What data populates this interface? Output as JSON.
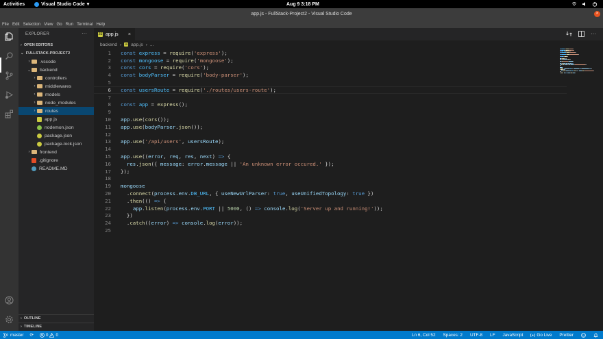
{
  "topbar": {
    "activities": "Activities",
    "app": "Visual Studio Code",
    "app_chevron": "▾",
    "clock": "Aug 9   3:18 PM",
    "tray_icons": [
      "network-icon",
      "volume-icon",
      "power-icon"
    ]
  },
  "window": {
    "title": "app.js - FullStack-Project2 - Visual Studio Code",
    "close_glyph": "×"
  },
  "menu": [
    "File",
    "Edit",
    "Selection",
    "View",
    "Go",
    "Run",
    "Terminal",
    "Help"
  ],
  "sidebar": {
    "title": "EXPLORER",
    "more": "···",
    "open_editors": "OPEN EDITORS",
    "project": "FULLSTACK-PROJECT2",
    "outline": "OUTLINE",
    "timeline": "TIMELINE",
    "tree": [
      {
        "label": ".vscode",
        "kind": "folder",
        "indent": 1,
        "expanded": false
      },
      {
        "label": "backend",
        "kind": "folder",
        "indent": 1,
        "expanded": true
      },
      {
        "label": "controllers",
        "kind": "folder",
        "indent": 2,
        "expanded": false
      },
      {
        "label": "middlewares",
        "kind": "folder",
        "indent": 2,
        "expanded": false
      },
      {
        "label": "models",
        "kind": "folder",
        "indent": 2,
        "expanded": false
      },
      {
        "label": "node_modules",
        "kind": "folder",
        "indent": 2,
        "expanded": false
      },
      {
        "label": "routes",
        "kind": "folder",
        "indent": 2,
        "expanded": false,
        "selected": true
      },
      {
        "label": "app.js",
        "kind": "js",
        "indent": 2
      },
      {
        "label": "nodemon.json",
        "kind": "nodemon",
        "indent": 2
      },
      {
        "label": "package.json",
        "kind": "json",
        "indent": 2
      },
      {
        "label": "package-lock.json",
        "kind": "json",
        "indent": 2
      },
      {
        "label": "frontend",
        "kind": "folder",
        "indent": 1,
        "expanded": false
      },
      {
        "label": ".gitignore",
        "kind": "git",
        "indent": 1
      },
      {
        "label": "README.MD",
        "kind": "md",
        "indent": 1
      }
    ]
  },
  "tab": {
    "label": "app.js",
    "icon": "JS",
    "close": "×"
  },
  "breadcrumb": {
    "folder": "backend",
    "sep": "›",
    "file": "app.js",
    "more": "..."
  },
  "editor": {
    "current_line": 6,
    "lines": [
      [
        [
          "kw",
          "const "
        ],
        [
          "cls",
          "express"
        ],
        [
          "plain",
          " = "
        ],
        [
          "fn",
          "require"
        ],
        [
          "plain",
          "("
        ],
        [
          "str",
          "'express'"
        ],
        [
          "plain",
          ");"
        ]
      ],
      [
        [
          "kw",
          "const "
        ],
        [
          "cls",
          "mongoose"
        ],
        [
          "plain",
          " = "
        ],
        [
          "fn",
          "require"
        ],
        [
          "plain",
          "("
        ],
        [
          "str",
          "'mongoose'"
        ],
        [
          "plain",
          ");"
        ]
      ],
      [
        [
          "kw",
          "const "
        ],
        [
          "cls",
          "cors"
        ],
        [
          "plain",
          " = "
        ],
        [
          "fn",
          "require"
        ],
        [
          "plain",
          "("
        ],
        [
          "str",
          "'cors'"
        ],
        [
          "plain",
          ");"
        ]
      ],
      [
        [
          "kw",
          "const "
        ],
        [
          "cls",
          "bodyParser"
        ],
        [
          "plain",
          " = "
        ],
        [
          "fn",
          "require"
        ],
        [
          "plain",
          "("
        ],
        [
          "str",
          "'body-parser'"
        ],
        [
          "plain",
          ");"
        ]
      ],
      [],
      [
        [
          "kw",
          "const "
        ],
        [
          "cls",
          "usersRoute"
        ],
        [
          "plain",
          " = "
        ],
        [
          "fn",
          "require"
        ],
        [
          "plain",
          "("
        ],
        [
          "str",
          "'./routes/users-route'"
        ],
        [
          "plain",
          ");"
        ]
      ],
      [],
      [
        [
          "kw",
          "const "
        ],
        [
          "cls",
          "app"
        ],
        [
          "plain",
          " = "
        ],
        [
          "fn",
          "express"
        ],
        [
          "plain",
          "();"
        ]
      ],
      [],
      [
        [
          "var",
          "app"
        ],
        [
          "plain",
          "."
        ],
        [
          "fn",
          "use"
        ],
        [
          "plain",
          "("
        ],
        [
          "fn",
          "cors"
        ],
        [
          "plain",
          "());"
        ]
      ],
      [
        [
          "var",
          "app"
        ],
        [
          "plain",
          "."
        ],
        [
          "fn",
          "use"
        ],
        [
          "plain",
          "("
        ],
        [
          "var",
          "bodyParser"
        ],
        [
          "plain",
          "."
        ],
        [
          "fn",
          "json"
        ],
        [
          "plain",
          "());"
        ]
      ],
      [],
      [
        [
          "var",
          "app"
        ],
        [
          "plain",
          "."
        ],
        [
          "fn",
          "use"
        ],
        [
          "plain",
          "("
        ],
        [
          "str",
          "'/api/users'"
        ],
        [
          "plain",
          ", "
        ],
        [
          "var",
          "usersRoute"
        ],
        [
          "plain",
          ");"
        ]
      ],
      [],
      [
        [
          "var",
          "app"
        ],
        [
          "plain",
          "."
        ],
        [
          "fn",
          "use"
        ],
        [
          "plain",
          "(("
        ],
        [
          "var",
          "error"
        ],
        [
          "plain",
          ", "
        ],
        [
          "var",
          "req"
        ],
        [
          "plain",
          ", "
        ],
        [
          "var",
          "res"
        ],
        [
          "plain",
          ", "
        ],
        [
          "var",
          "next"
        ],
        [
          "plain",
          ") "
        ],
        [
          "kw",
          "=>"
        ],
        [
          "plain",
          " {"
        ]
      ],
      [
        [
          "plain",
          "  "
        ],
        [
          "var",
          "res"
        ],
        [
          "plain",
          "."
        ],
        [
          "fn",
          "json"
        ],
        [
          "plain",
          "({ "
        ],
        [
          "var",
          "message"
        ],
        [
          "plain",
          ": "
        ],
        [
          "var",
          "error"
        ],
        [
          "plain",
          "."
        ],
        [
          "var",
          "message"
        ],
        [
          "plain",
          " || "
        ],
        [
          "str",
          "'An unknown error occured.'"
        ],
        [
          "plain",
          " });"
        ]
      ],
      [
        [
          "plain",
          "});"
        ]
      ],
      [],
      [
        [
          "var",
          "mongoose"
        ]
      ],
      [
        [
          "plain",
          "  ."
        ],
        [
          "fn",
          "connect"
        ],
        [
          "plain",
          "("
        ],
        [
          "var",
          "process"
        ],
        [
          "plain",
          "."
        ],
        [
          "var",
          "env"
        ],
        [
          "plain",
          "."
        ],
        [
          "cls",
          "DB_URL"
        ],
        [
          "plain",
          ", { "
        ],
        [
          "var",
          "useNewUrlParser"
        ],
        [
          "plain",
          ": "
        ],
        [
          "kw",
          "true"
        ],
        [
          "plain",
          ", "
        ],
        [
          "var",
          "useUnifiedTopology"
        ],
        [
          "plain",
          ": "
        ],
        [
          "kw",
          "true"
        ],
        [
          "plain",
          " })"
        ]
      ],
      [
        [
          "plain",
          "  ."
        ],
        [
          "fn",
          "then"
        ],
        [
          "plain",
          "(() "
        ],
        [
          "kw",
          "=>"
        ],
        [
          "plain",
          " {"
        ]
      ],
      [
        [
          "plain",
          "    "
        ],
        [
          "var",
          "app"
        ],
        [
          "plain",
          "."
        ],
        [
          "fn",
          "listen"
        ],
        [
          "plain",
          "("
        ],
        [
          "var",
          "process"
        ],
        [
          "plain",
          "."
        ],
        [
          "var",
          "env"
        ],
        [
          "plain",
          "."
        ],
        [
          "cls",
          "PORT"
        ],
        [
          "plain",
          " || "
        ],
        [
          "num",
          "5000"
        ],
        [
          "plain",
          ", () "
        ],
        [
          "kw",
          "=>"
        ],
        [
          "plain",
          " "
        ],
        [
          "var",
          "console"
        ],
        [
          "plain",
          "."
        ],
        [
          "fn",
          "log"
        ],
        [
          "plain",
          "("
        ],
        [
          "str",
          "'Server up and running!'"
        ],
        [
          "plain",
          "));"
        ]
      ],
      [
        [
          "plain",
          "  })"
        ]
      ],
      [
        [
          "plain",
          "  ."
        ],
        [
          "fn",
          "catch"
        ],
        [
          "plain",
          "(("
        ],
        [
          "var",
          "error"
        ],
        [
          "plain",
          ") "
        ],
        [
          "kw",
          "=>"
        ],
        [
          "plain",
          " "
        ],
        [
          "var",
          "console"
        ],
        [
          "plain",
          "."
        ],
        [
          "fn",
          "log"
        ],
        [
          "plain",
          "("
        ],
        [
          "var",
          "error"
        ],
        [
          "plain",
          "));"
        ]
      ],
      []
    ]
  },
  "status": {
    "branch": "master",
    "sync_glyph": "⟳",
    "errors": "0",
    "warnings": "0",
    "position": "Ln 6, Col 52",
    "spaces": "Spaces: 2",
    "encoding": "UTF-8",
    "eol": "LF",
    "language": "JavaScript",
    "golive": "Go Live",
    "prettier": "Prettier"
  },
  "colors": {
    "status_bar": "#007acc",
    "selection": "#094771",
    "keyword": "#569cd6",
    "function": "#dcdcaa",
    "string": "#ce9178",
    "variable": "#9cdcfe"
  }
}
